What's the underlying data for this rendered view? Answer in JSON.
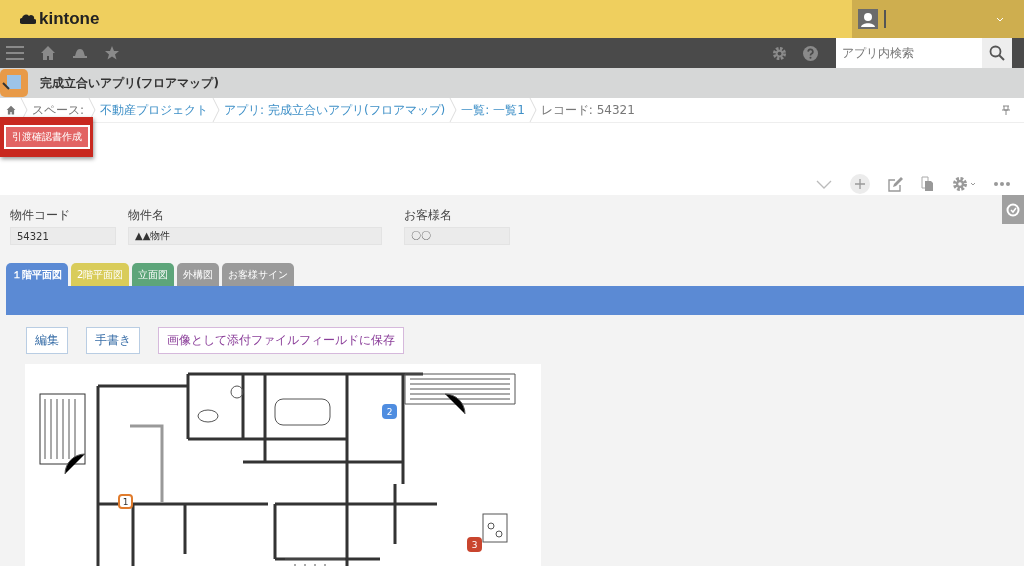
{
  "header": {
    "logo": "kintone"
  },
  "navbar": {
    "search": {
      "placeholder": "アプリ内検索"
    }
  },
  "app": {
    "title": "完成立合いアプリ(フロアマップ)"
  },
  "breadcrumb": [
    {
      "label": "スペース:",
      "link": false
    },
    {
      "label": "不動産プロジェクト",
      "link": true
    },
    {
      "label": "アプリ: 完成立合いアプリ(フロアマップ)",
      "link": true
    },
    {
      "label": "一覧: 一覧1",
      "link": true
    },
    {
      "label": "レコード: 54321",
      "link": false
    }
  ],
  "custom_button": {
    "label": "引渡確認書作成",
    "highlighted": true
  },
  "fields": [
    {
      "label": "物件コード",
      "value": "54321"
    },
    {
      "label": "物件名",
      "value": "▲▲物件"
    },
    {
      "label": "お客様名",
      "value": "〇〇"
    }
  ],
  "tabs": [
    {
      "label": "１階平面図",
      "color": "#5b8ad4",
      "selected": true
    },
    {
      "label": "2階平面図",
      "color": "#d9cc5a",
      "selected": false
    },
    {
      "label": "立面図",
      "color": "#5da57a",
      "selected": false
    },
    {
      "label": "外構図",
      "color": "#9a9a9a",
      "selected": false
    },
    {
      "label": "お客様サイン",
      "color": "#9a9a9a",
      "selected": false
    }
  ],
  "plan_buttons": [
    {
      "label": "編集",
      "kind": "plain"
    },
    {
      "label": "手書き",
      "kind": "plain"
    },
    {
      "label": "画像として添付ファイルフィールドに保存",
      "kind": "save"
    }
  ],
  "markers": [
    {
      "label": "1",
      "color": "#e07b2c",
      "filled": false
    },
    {
      "label": "2",
      "color": "#4f8de0",
      "filled": true
    },
    {
      "label": "3",
      "color": "#c9452e",
      "filled": true
    }
  ]
}
